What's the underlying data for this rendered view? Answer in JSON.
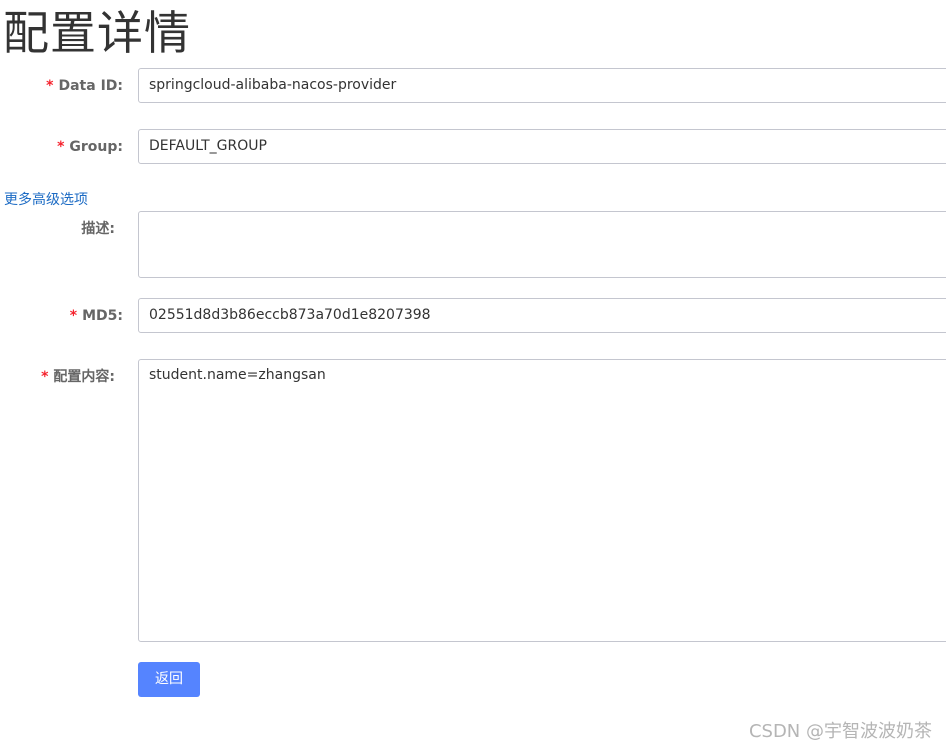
{
  "page": {
    "title": "配置详情"
  },
  "form": {
    "data_id": {
      "required_mark": "*",
      "label": "Data ID:",
      "value": "springcloud-alibaba-nacos-provider"
    },
    "group": {
      "required_mark": "*",
      "label": "Group:",
      "value": "DEFAULT_GROUP"
    },
    "advanced_link": "更多高级选项",
    "description": {
      "label": "描述:",
      "value": ""
    },
    "md5": {
      "required_mark": "*",
      "label": "MD5:",
      "value": "02551d8d3b86eccb873a70d1e8207398"
    },
    "content": {
      "required_mark": "*",
      "label": "配置内容:",
      "value": "student.name=zhangsan"
    },
    "back_button": "返回"
  },
  "watermark": "CSDN @宇智波波奶茶",
  "colors": {
    "required": "#f5222d",
    "link": "#1c6bc4",
    "primary_button": "#5584ff",
    "input_border": "#c4c6cf"
  }
}
